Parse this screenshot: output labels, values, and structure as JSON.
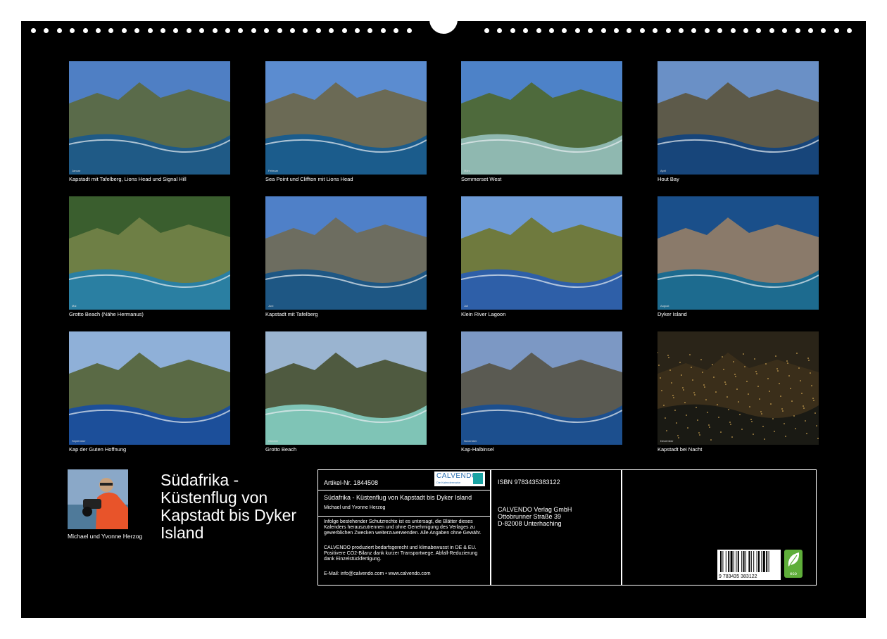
{
  "months": [
    {
      "caption": "Kapstadt mit Tafelberg, Lions Head und Signal Hill",
      "month_label": "Januar",
      "sky": "#4f7fc4",
      "land": "#5a6b4a",
      "sea": "#1f5a86"
    },
    {
      "caption": "Sea Point und Cliffton mit Lions Head",
      "month_label": "Februar",
      "sky": "#5b8cd0",
      "land": "#6b6a55",
      "sea": "#1b5c8c"
    },
    {
      "caption": "Sommerset West",
      "month_label": "März",
      "sky": "#4d82c8",
      "land": "#4e6a3c",
      "sea": "#8fb8b0"
    },
    {
      "caption": "Hout Bay",
      "month_label": "April",
      "sky": "#6a90c6",
      "land": "#5d5a4a",
      "sea": "#17457a"
    },
    {
      "caption": "Grotto Beach (Nähe Hermanus)",
      "month_label": "Mai",
      "sky": "#3a5e2e",
      "land": "#6e7f45",
      "sea": "#2a7fa2"
    },
    {
      "caption": "Kapstadt mit Tafelberg",
      "month_label": "Juni",
      "sky": "#4f80c8",
      "land": "#6d6d60",
      "sea": "#1e5784"
    },
    {
      "caption": "Klein River Lagoon",
      "month_label": "Juli",
      "sky": "#6d9ad6",
      "land": "#6f7a3e",
      "sea": "#2e5fa8"
    },
    {
      "caption": "Dyker Island",
      "month_label": "August",
      "sky": "#1a4f8a",
      "land": "#8a7a6a",
      "sea": "#1d6b8f"
    },
    {
      "caption": "Kap der Guten Hoffnung",
      "month_label": "September",
      "sky": "#8fb0d8",
      "land": "#5a6a45",
      "sea": "#1c4f9a"
    },
    {
      "caption": "Grotto Beach",
      "month_label": "Oktober",
      "sky": "#9ab4d0",
      "land": "#4f5a40",
      "sea": "#7fc4b6"
    },
    {
      "caption": "Kap-Halbinsel",
      "month_label": "November",
      "sky": "#7c98c4",
      "land": "#5a5a52",
      "sea": "#1c4f8e"
    },
    {
      "caption": "Kapstadt bei Nacht",
      "month_label": "Dezember",
      "sky": "#2a2418",
      "land": "#3a2e1a",
      "sea": "#1a1a14"
    }
  ],
  "author": {
    "name": "Michael und Yvonne Herzog"
  },
  "title": "Südafrika - Küstenflug von Kapstadt bis Dyker Island",
  "info": {
    "article_nr": "Artikel-Nr. 1844508",
    "logo_text": "CALVENDO",
    "logo_sub": "Die Kalendermarke",
    "subtitle": "Südafrika - Küstenflug von Kapstadt bis Dyker Island",
    "author_small": "Michael und Yvonne Herzog",
    "legal_1": "Infolge bestehender Schutzrechte ist es untersagt, die Blätter dieses Kalenders herauszutrennen und ohne Genehmigung des Verlages zu gewerblichen Zwecken weiterzuverwenden. Alle Angaben ohne Gewähr.",
    "legal_2": "CALVENDO produziert bedarfsgerecht und klimabewusst in DE & EU. Positivere CO2-Bilanz dank kurzer Transportwege. Abfall-Reduzierung dank Einzelstückfertigung.",
    "email": "E-Mail: info@calvendo.com • www.calvendo.com",
    "isbn": "ISBN 9783435383122",
    "publisher": "CALVENDO Verlag GmbH",
    "street": "Ottobrunner Straße 39",
    "city": "D-82008 Unterhaching",
    "barcode_digits": "9 783435 383122",
    "eco_label": "eco"
  },
  "colors": {
    "background": "#000000",
    "text": "#ffffff",
    "brand": "#2a6fb0"
  }
}
